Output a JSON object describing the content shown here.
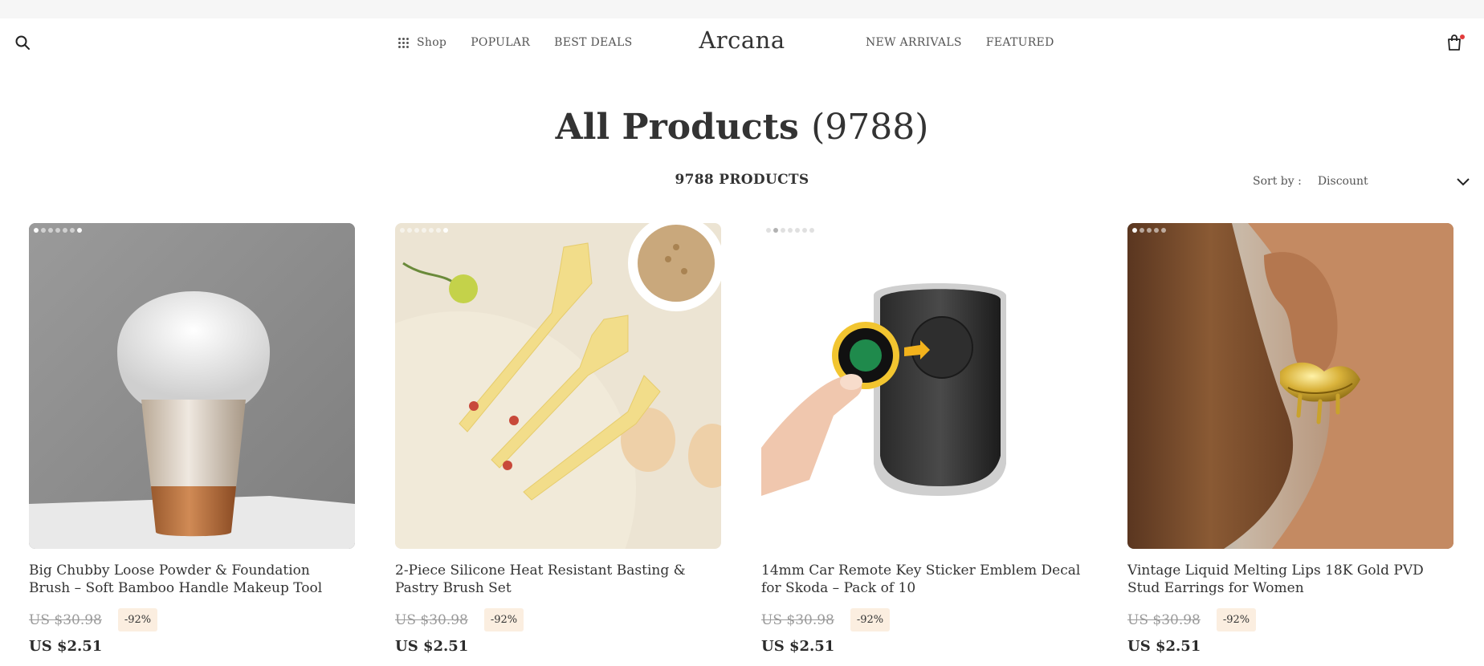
{
  "header": {
    "brand": "Arcana",
    "nav_left": [
      {
        "label": "Shop",
        "icon": "grid-icon"
      },
      {
        "label": "POPULAR"
      },
      {
        "label": "BEST DEALS"
      }
    ],
    "nav_right": [
      {
        "label": "NEW ARRIVALS"
      },
      {
        "label": "FEATURED"
      }
    ],
    "search_icon": "search-icon",
    "cart_icon": "shopping-bag-icon",
    "cart_badge_color": "#e23b3b"
  },
  "page": {
    "title": "All Products",
    "title_count": "(9788)",
    "product_count_label": "9788 PRODUCTS"
  },
  "sort": {
    "label": "Sort by :",
    "value": "Discount"
  },
  "colors": {
    "discount_badge_bg": "#fbeee0",
    "text": "#2b2b2b"
  },
  "products": [
    {
      "title": "Big Chubby Loose Powder & Foundation Brush – Soft Bamboo Handle Makeup Tool",
      "old_price": "US $30.98",
      "discount": "-92%",
      "price": "US $2.51",
      "image": "makeup-brush-image",
      "image_dots": 7
    },
    {
      "title": "2-Piece Silicone Heat Resistant Basting & Pastry Brush Set",
      "old_price": "US $30.98",
      "discount": "-92%",
      "price": "US $2.51",
      "image": "silicone-spatula-brush-image",
      "image_dots": 7
    },
    {
      "title": "14mm Car Remote Key Sticker Emblem Decal for Skoda – Pack of 10",
      "old_price": "US $30.98",
      "discount": "-92%",
      "price": "US $2.51",
      "image": "car-key-emblem-image",
      "image_dots": 7
    },
    {
      "title": "Vintage Liquid Melting Lips 18K Gold PVD Stud Earrings for Women",
      "old_price": "US $30.98",
      "discount": "-92%",
      "price": "US $2.51",
      "image": "gold-lips-earring-image",
      "image_dots": 5
    }
  ]
}
